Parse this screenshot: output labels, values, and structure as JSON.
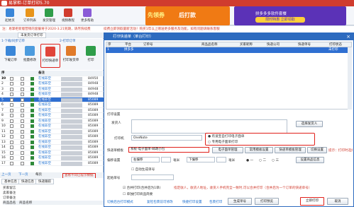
{
  "app": {
    "title": "易掌柜-订单打印5.70"
  },
  "toolbar": {
    "buttons": [
      "起始页",
      "订单列表",
      "发货管理",
      "视频教程",
      "更多帮助"
    ]
  },
  "banner": {
    "main": "先领券",
    "main2": "后打款",
    "side_line1": "拼多多多软件套餐",
    "side_cta": "限时特惠 立即领取"
  },
  "notice": {
    "left": "注：易掌柜新版营销的套餐将于2020-3.21到期，请尽快续费",
    "right": "续费立即领取最新活动！购买1年以上赠送更多服务及功能，如有问题请联系客服"
  },
  "left": {
    "tabs": [
      "未发货订单打印"
    ],
    "subtabs": [
      "1-下载/同步订单",
      "2-打印订单"
    ],
    "tools": [
      "下载订单",
      "批量修改",
      "打印快递单",
      "打印发货单",
      "打印"
    ],
    "grid_header": {
      "idx": "序39",
      "check": "",
      "remark": "备注"
    },
    "rows": [
      {
        "n": "1",
        "status": "在线非空",
        "num": "84950"
      },
      {
        "n": "2",
        "status": "在线非空",
        "num": "84948"
      },
      {
        "n": "3",
        "status": "在线非空",
        "num": "84948"
      },
      {
        "n": "4",
        "status": "在线非空",
        "num": "84948"
      },
      {
        "n": "5",
        "status": "在线非空",
        "num": "85089"
      },
      {
        "n": "6",
        "status": "在线非空",
        "num": "85089"
      },
      {
        "n": "7",
        "status": "在线非空",
        "num": "85089"
      },
      {
        "n": "8",
        "status": "在线非空",
        "num": "85089"
      },
      {
        "n": "9",
        "status": "在线非空",
        "num": "85089"
      },
      {
        "n": "10",
        "status": "在线非空",
        "num": "85089"
      },
      {
        "n": "11",
        "status": "在线非空",
        "num": "85089"
      },
      {
        "n": "12",
        "status": "在线非空",
        "num": "85089"
      },
      {
        "n": "13",
        "status": "在线非空",
        "num": "85089"
      },
      {
        "n": "14",
        "status": "在线非空",
        "num": "85089"
      },
      {
        "n": "15",
        "status": "在线非空",
        "num": "85089"
      },
      {
        "n": "16",
        "status": "在线非空",
        "num": "85089"
      },
      {
        "n": "17",
        "status": "在线非空",
        "num": "85089"
      }
    ],
    "footer": {
      "prev": "上一页",
      "next": "下一页",
      "page_size": "每页",
      "hint": "查看不同已提示数据"
    },
    "bottom_tabs": [
      "基本信息",
      "快递信息",
      "快递跟踪"
    ],
    "info_labels": [
      "买家留言",
      "卖家备注",
      "订单备注"
    ],
    "product_header": [
      "商品品名",
      "商品名称"
    ],
    "product_row": "适用于 此安全面 ..."
  },
  "dialog": {
    "title": "打印快递单（单台打印）",
    "columns": [
      "序",
      "平台",
      "订单号",
      "商品品名称",
      "买家昵称",
      "快递公司",
      "快递单号",
      "打印状态"
    ],
    "row": {
      "seq": "1",
      "platform": "拼多多",
      "status": "未打印"
    },
    "print_settings": "打印设置",
    "sender_label": "发货人",
    "choose_sender": "选择发货人",
    "printer_label": "打印机",
    "printer_value": "OneNote",
    "radio_ecology": "专用电子面单打印",
    "radio_normal": "有道宝自打印电子面单",
    "tpl_label": "快递单模板",
    "tpl_value": "系统-电子面单-邮政小包",
    "tpl_buttons": [
      "电子面单管理",
      "常用模板设置",
      "快递单模板管理",
      "切换设置"
    ],
    "preview_pct": "提示：打印时选择的面单",
    "margin_label": "偏移设置",
    "margin_h": "右偏移",
    "margin_v": "下偏移",
    "unit": "毫米",
    "radio_one": "一",
    "radio_two": "二",
    "radio_three": "三",
    "goods_setting": "设置商品信息",
    "auto_label": "自动生成单号",
    "start_label": "起始单号",
    "merge": "合并打印(合并后为1单)",
    "single_print": "单独打印商品简要",
    "hint_text": "指定收人，收货人地址，收货人手机完全一致时,可以合并打印（合并后为一个订单的快递单号）",
    "bottom_links": [
      "切换后台打印模式",
      "复检包裹前可修改",
      "快捷打印设置",
      "包裹打印"
    ],
    "btn_generate": "生成单号",
    "btn_preview": "打印预览",
    "btn_print": "立即打印",
    "btn_cancel": "取消"
  }
}
